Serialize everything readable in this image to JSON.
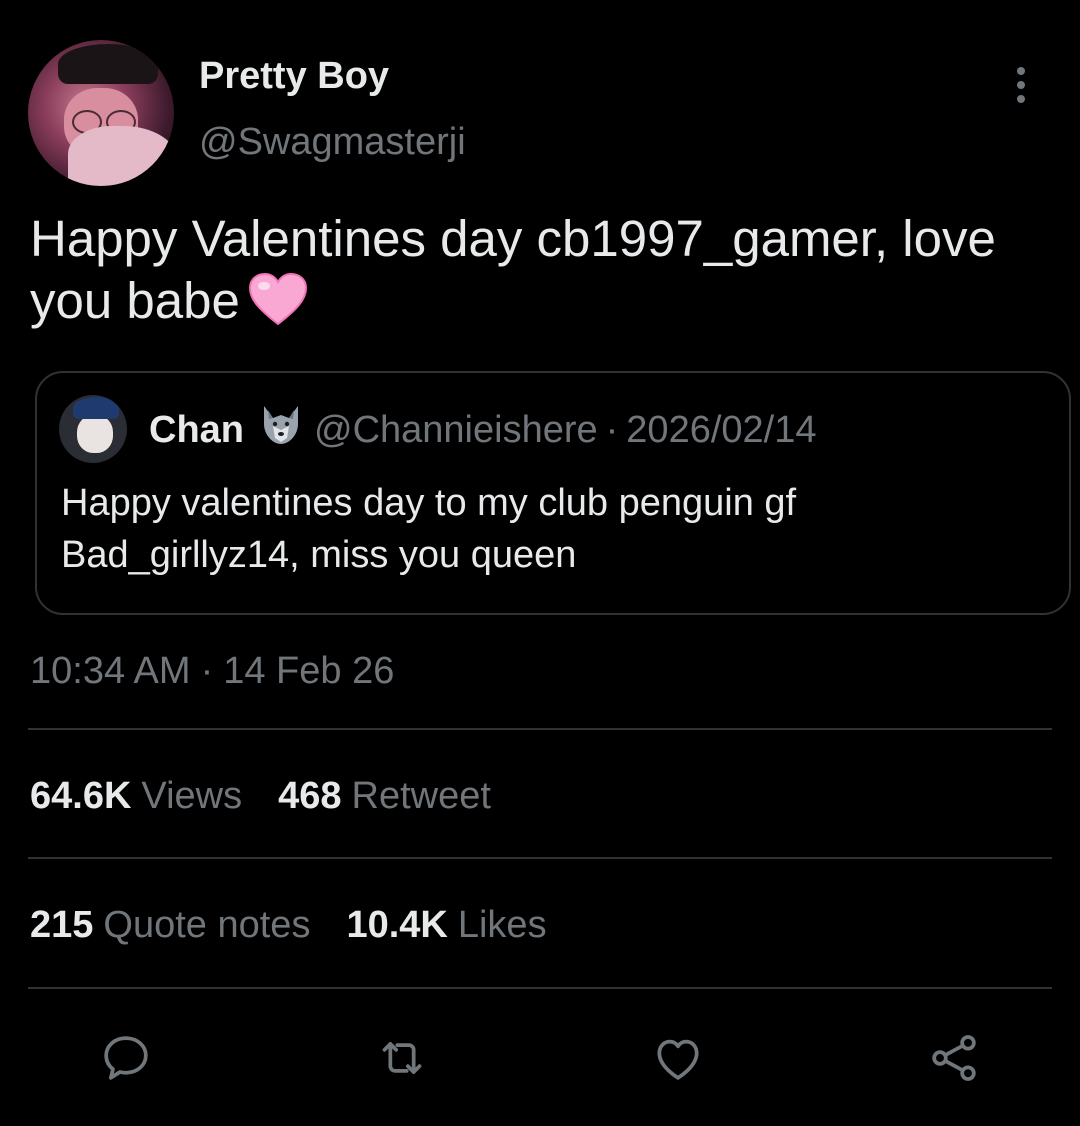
{
  "tweet": {
    "author": {
      "display_name": "Pretty Boy",
      "handle": "@Swagmasterji"
    },
    "text": "Happy Valentines day cb1997_gamer, love you babe",
    "emoji": "pink-heart",
    "quoted": {
      "display_name": "Chan",
      "emoji": "wolf",
      "handle": "@Channieishere",
      "separator": "·",
      "date": "2026/02/14",
      "text": "Happy valentines day to my club penguin gf Bad_girllyz14, miss you queen"
    },
    "time": "10:34 AM",
    "time_separator": "·",
    "date": "14 Feb 26"
  },
  "stats": {
    "views": {
      "count": "64.6K",
      "label": "Views"
    },
    "retweets": {
      "count": "468",
      "label": "Retweet"
    },
    "quotes": {
      "count": "215",
      "label": "Quote notes"
    },
    "likes": {
      "count": "10.4K",
      "label": "Likes"
    }
  },
  "actions": [
    "reply-icon",
    "retweet-icon",
    "like-icon",
    "share-icon"
  ],
  "colors": {
    "background": "#000000",
    "text_primary": "#e7e9ea",
    "text_secondary": "#71767b",
    "border": "#2f3336",
    "heart_emoji": "#f9a8d4"
  }
}
